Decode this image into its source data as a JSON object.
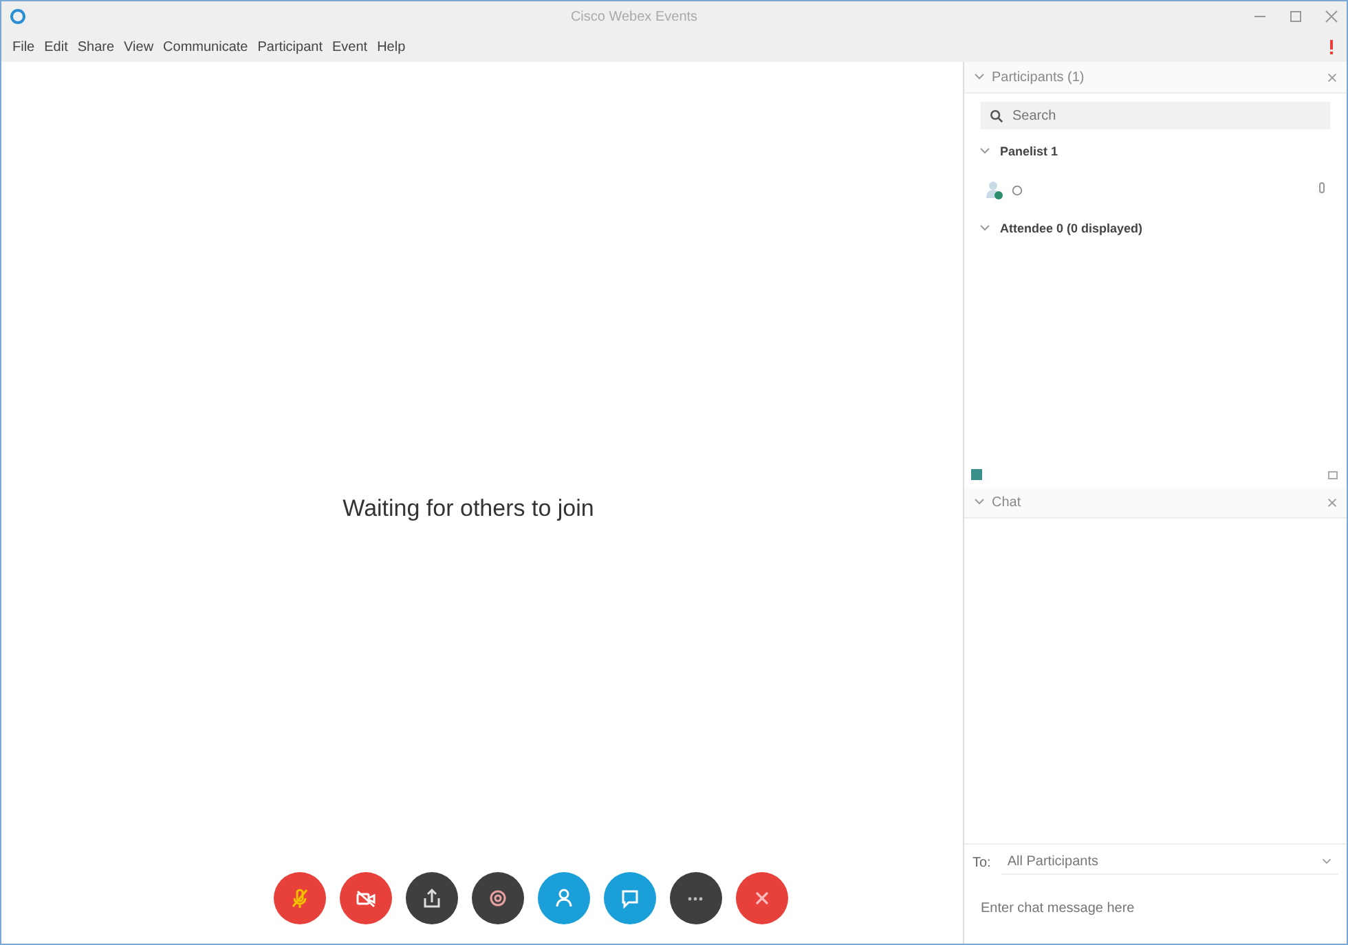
{
  "window": {
    "title": "Cisco Webex Events"
  },
  "menu": [
    "File",
    "Edit",
    "Share",
    "View",
    "Communicate",
    "Participant",
    "Event",
    "Help"
  ],
  "stage": {
    "message": "Waiting for others to join"
  },
  "controls": [
    {
      "kind": "mic",
      "color": "#e8403a"
    },
    {
      "kind": "video",
      "color": "#e8403a"
    },
    {
      "kind": "share",
      "color": "#3f3f3f"
    },
    {
      "kind": "record",
      "color": "#3f3f3f"
    },
    {
      "kind": "participants",
      "color": "#1a9fd8"
    },
    {
      "kind": "chat",
      "color": "#1a9fd8"
    },
    {
      "kind": "more",
      "color": "#3f3f3f"
    },
    {
      "kind": "leave",
      "color": "#e8403a"
    }
  ],
  "participants": {
    "title": "Participants (1)",
    "search": {
      "placeholder": "Search"
    },
    "groups": [
      {
        "label": "Panelist 1",
        "expanded": true,
        "members": [
          {
            "presenter": true
          }
        ]
      },
      {
        "label": "Attendee 0 (0 displayed)",
        "expanded": true
      }
    ]
  },
  "chat": {
    "title": "Chat",
    "to_label": "To:",
    "recipient": "All Participants",
    "message": {
      "placeholder": "Enter chat message here"
    }
  }
}
